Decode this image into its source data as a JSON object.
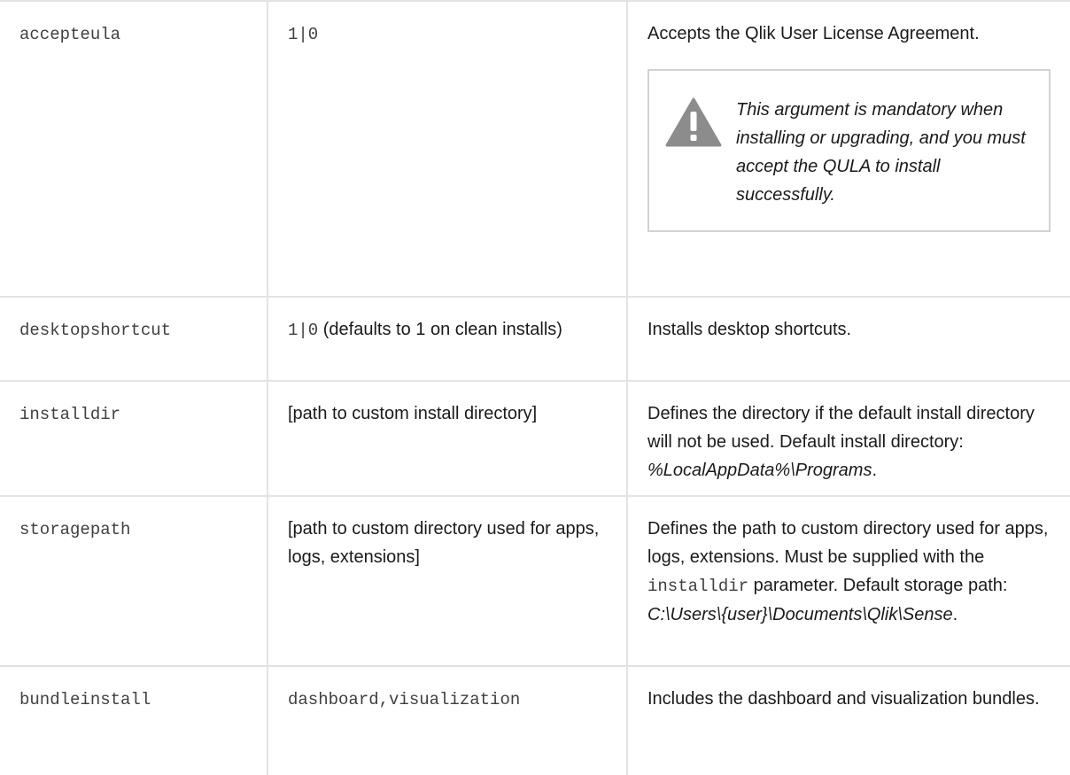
{
  "rows": [
    {
      "argument": "accepteula",
      "value_code": "1|0",
      "description": "Accepts the Qlik User License Agreement.",
      "warning": "This argument is mandatory when installing or upgrading, and you must accept the QULA to install successfully.",
      "warning_icon": "warning-triangle-icon"
    },
    {
      "argument": "desktopshortcut",
      "value_code": "1|0",
      "value_text": " (defaults to 1 on clean installs)",
      "description": "Installs desktop shortcuts."
    },
    {
      "argument": "installdir",
      "value_text": "[path to custom install directory]",
      "description": "Defines the directory if the default install directory will not be used. Default install directory: ",
      "description_em": "%LocalAppData%\\Programs",
      "description_end": "."
    },
    {
      "argument": "storagepath",
      "value_text": "[path to custom directory used for apps, logs, extensions]",
      "description": "Defines the path to custom directory used for apps, logs, extensions. Must be supplied with the ",
      "description_code": "installdir",
      "description_mid": " parameter. Default storage path: ",
      "description_em": "C:\\Users\\{user}\\Documents\\Qlik\\Sense",
      "description_end": "."
    },
    {
      "argument": "bundleinstall",
      "value_code": "dashboard,visualization",
      "description": "Includes the dashboard and visualization bundles."
    }
  ],
  "colors": {
    "border": "#e3e3e3",
    "warning_border": "#d2d2d2",
    "warning_icon": "#8c8c8c"
  }
}
